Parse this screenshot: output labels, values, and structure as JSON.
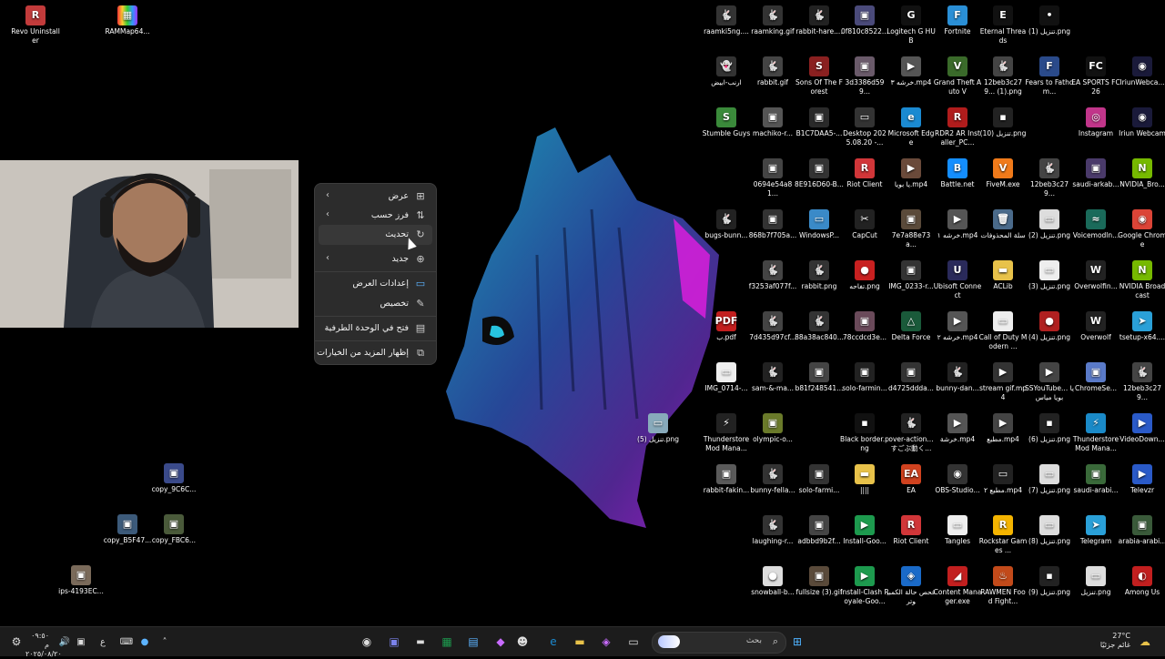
{
  "desktop": {
    "left_icons": [
      {
        "label": "Revo Uninstaller",
        "glyph": "R",
        "color": "#c23b3b"
      },
      {
        "label": "RAMMap64...",
        "glyph": "▦",
        "color": "#6b3fa0"
      },
      {
        "label": "copy_9C6C...",
        "glyph": "▣",
        "color": "#3a4a8a"
      },
      {
        "label": "copy_B5F47...",
        "glyph": "▣",
        "color": "#3c5a7a"
      },
      {
        "label": "copy_FBC6...",
        "glyph": "▣",
        "color": "#4a5a3a"
      },
      {
        "label": "ips-4193EC...",
        "glyph": "▣",
        "color": "#7a6a5a"
      }
    ],
    "grid_icons": [
      {
        "label": "raamki5ng....",
        "glyph": "🐇",
        "color": "#333"
      },
      {
        "label": "raamking.gif",
        "glyph": "🐇",
        "color": "#333"
      },
      {
        "label": "rabbit-hare....",
        "glyph": "🐇",
        "color": "#222"
      },
      {
        "label": "0f810c8522...",
        "glyph": "▣",
        "color": "#4a4a7a"
      },
      {
        "label": "Logitech G HUB",
        "glyph": "G",
        "color": "#111"
      },
      {
        "label": "Fortnite",
        "glyph": "F",
        "color": "#2a8fd6"
      },
      {
        "label": "Eternal Threads",
        "glyph": "E",
        "color": "#111"
      },
      {
        "label": "تنزيل (1).png",
        "glyph": "•",
        "color": "#111"
      },
      {
        "label": "ارنب-ابيض",
        "glyph": "👻",
        "color": "#333"
      },
      {
        "label": "rabbit.gif",
        "glyph": "🐇",
        "color": "#444"
      },
      {
        "label": "Sons Of The Forest",
        "glyph": "S",
        "color": "#8a2020"
      },
      {
        "label": "3d3386d599...",
        "glyph": "▣",
        "color": "#6a5a6a"
      },
      {
        "label": "خرشه ٣.mp4",
        "glyph": "▶",
        "color": "#555"
      },
      {
        "label": "Grand Theft Auto V",
        "glyph": "V",
        "color": "#3a6a2a"
      },
      {
        "label": "12beb3c279... (1).png",
        "glyph": "🐇",
        "color": "#444"
      },
      {
        "label": "Fears to Fathom...",
        "glyph": "F",
        "color": "#2a4a8a"
      },
      {
        "label": "EA SPORTS FC 26",
        "glyph": "FC",
        "color": "#111"
      },
      {
        "label": "IriunWebca...",
        "glyph": "◉",
        "color": "#1a1a3a"
      },
      {
        "label": "Stumble Guys",
        "glyph": "S",
        "color": "#3a8a3a"
      },
      {
        "label": "machiko-r...",
        "glyph": "▣",
        "color": "#555"
      },
      {
        "label": "B1C7DAA5-...",
        "glyph": "▣",
        "color": "#2a2a2a"
      },
      {
        "label": "Desktop 2025.08.20 -...",
        "glyph": "▭",
        "color": "#333"
      },
      {
        "label": "Microsoft Edge",
        "glyph": "e",
        "color": "#1b8ad1"
      },
      {
        "label": "RDR2 AR Installer_PC...",
        "glyph": "R",
        "color": "#b01c1c"
      },
      {
        "label": "تنزيل (10).png",
        "glyph": "▪",
        "color": "#222"
      },
      {
        "label": "Instagram",
        "glyph": "◎",
        "color": "#c1358a"
      },
      {
        "label": "Iriun Webcam",
        "glyph": "◉",
        "color": "#1a1a3a"
      },
      {
        "label": "0694e54a81...",
        "glyph": "▣",
        "color": "#444"
      },
      {
        "label": "8E916D60-B...",
        "glyph": "▣",
        "color": "#333"
      },
      {
        "label": "Riot Client",
        "glyph": "R",
        "color": "#d13639"
      },
      {
        "label": "يا بويا.mp4",
        "glyph": "▶",
        "color": "#6a4a3a"
      },
      {
        "label": "Battle.net",
        "glyph": "B",
        "color": "#148eff"
      },
      {
        "label": "FiveM.exe",
        "glyph": "V",
        "color": "#f07a1a"
      },
      {
        "label": "12beb3c279...",
        "glyph": "🐇",
        "color": "#444"
      },
      {
        "label": "saudi-arkab...",
        "glyph": "▣",
        "color": "#4a3a6a"
      },
      {
        "label": "NVIDIA_Bro...",
        "glyph": "N",
        "color": "#76b900"
      },
      {
        "label": "bugs-bunn...",
        "glyph": "🐇",
        "color": "#222"
      },
      {
        "label": "868b7f705a...",
        "glyph": "▣",
        "color": "#333"
      },
      {
        "label": "WindowsP...",
        "glyph": "▭",
        "color": "#3a8ac8"
      },
      {
        "label": "CapCut",
        "glyph": "✂",
        "color": "#222"
      },
      {
        "label": "7e7a88e73a...",
        "glyph": "▣",
        "color": "#5a4a3a"
      },
      {
        "label": "خرشه ١.mp4",
        "glyph": "▶",
        "color": "#555"
      },
      {
        "label": "سلة المحذوفات",
        "glyph": "🗑",
        "color": "#4a6a8a"
      },
      {
        "label": "تنزيل (2).png",
        "glyph": "▭",
        "color": "#ddd"
      },
      {
        "label": "Voicemodln...",
        "glyph": "≈",
        "color": "#1a6a5a"
      },
      {
        "label": "Google Chrome",
        "glyph": "◉",
        "color": "#db4437"
      },
      {
        "label": "f3253af077f...",
        "glyph": "🐇",
        "color": "#444"
      },
      {
        "label": "rabbit.png",
        "glyph": "🐇",
        "color": "#333"
      },
      {
        "label": "تفاحه.png",
        "glyph": "●",
        "color": "#c82020"
      },
      {
        "label": "IMG_0233-r...",
        "glyph": "▣",
        "color": "#333"
      },
      {
        "label": "Ubisoft Connect",
        "glyph": "U",
        "color": "#2a2a5a"
      },
      {
        "label": "ACLib",
        "glyph": "▬",
        "color": "#e8c24a"
      },
      {
        "label": "تنزيل (3).png",
        "glyph": "▭",
        "color": "#eee"
      },
      {
        "label": "Overwolfin...",
        "glyph": "W",
        "color": "#222"
      },
      {
        "label": "NVIDIA Broadcast",
        "glyph": "N",
        "color": "#76b900"
      },
      {
        "label": "ب.pdf",
        "glyph": "PDF",
        "color": "#c21f1f"
      },
      {
        "label": "7d435d97cf...",
        "glyph": "🐇",
        "color": "#444"
      },
      {
        "label": "88a38ac840...",
        "glyph": "🐇",
        "color": "#333"
      },
      {
        "label": "78ccdcd3e...",
        "glyph": "▣",
        "color": "#6a4a5a"
      },
      {
        "label": "Delta Force",
        "glyph": "△",
        "color": "#1a5a3a"
      },
      {
        "label": "خرشه ٢.mp4",
        "glyph": "▶",
        "color": "#555"
      },
      {
        "label": "Call of Duty Modern ...",
        "glyph": "▭",
        "color": "#eee"
      },
      {
        "label": "تنزيل (4).png",
        "glyph": "●",
        "color": "#b02020"
      },
      {
        "label": "Overwolf",
        "glyph": "W",
        "color": "#222"
      },
      {
        "label": "tsetup-x64....",
        "glyph": "➤",
        "color": "#2aa0d8"
      },
      {
        "label": "IMG_0714-...",
        "glyph": "▭",
        "color": "#eee"
      },
      {
        "label": "sam-&-ma...",
        "glyph": "🐇",
        "color": "#222"
      },
      {
        "label": "b81f248541...",
        "glyph": "▣",
        "color": "#444"
      },
      {
        "label": "solo-farmin...",
        "glyph": "▣",
        "color": "#222"
      },
      {
        "label": "d4725ddda...",
        "glyph": "▣",
        "color": "#333"
      },
      {
        "label": "bunny-dan...",
        "glyph": "🐇",
        "color": "#222"
      },
      {
        "label": "stream gif.mp4",
        "glyph": "▶",
        "color": "#333"
      },
      {
        "label": "SSYouTube... يابويا مياس",
        "glyph": "▶",
        "color": "#444"
      },
      {
        "label": "ChromeSe...",
        "glyph": "▣",
        "color": "#5a7ac8"
      },
      {
        "label": "12beb3c279...",
        "glyph": "🐇",
        "color": "#444"
      },
      {
        "label": "تنزيل (5).png",
        "glyph": "▭",
        "color": "#8ab"
      },
      {
        "label": "Thunderstore Mod Mana...",
        "glyph": "⚡",
        "color": "#222"
      },
      {
        "label": "olympic-o...",
        "glyph": "▣",
        "color": "#6a7a2a"
      },
      {
        "label": "Black border.png",
        "glyph": "▪",
        "color": "#111"
      },
      {
        "label": "over-action... すごぶ動く...",
        "glyph": "🐇",
        "color": "#222"
      },
      {
        "label": "خرشة.mp4",
        "glyph": "▶",
        "color": "#555"
      },
      {
        "label": "مطبع.mp4",
        "glyph": "▶",
        "color": "#444"
      },
      {
        "label": "تنزيل (6).png",
        "glyph": "▪",
        "color": "#222"
      },
      {
        "label": "Thunderstore Mod Mana...",
        "glyph": "⚡",
        "color": "#1a8ac8"
      },
      {
        "label": "VideoDown...",
        "glyph": "▶",
        "color": "#2a5ac8"
      },
      {
        "label": "rabbit-fakin...",
        "glyph": "▣",
        "color": "#5a5a5a"
      },
      {
        "label": "bunny-fella...",
        "glyph": "🐇",
        "color": "#333"
      },
      {
        "label": "solo-farmi...",
        "glyph": "▣",
        "color": "#333"
      },
      {
        "label": "||||",
        "glyph": "▬",
        "color": "#e8c24a"
      },
      {
        "label": "EA",
        "glyph": "EA",
        "color": "#d0421f"
      },
      {
        "label": "OBS-Studio...",
        "glyph": "◉",
        "color": "#333"
      },
      {
        "label": "مطبع ٢.mp4",
        "glyph": "▭",
        "color": "#222"
      },
      {
        "label": "تنزيل (7).png",
        "glyph": "▭",
        "color": "#ddd"
      },
      {
        "label": "saudi-arabi...",
        "glyph": "▣",
        "color": "#3a6a3a"
      },
      {
        "label": "Televzr",
        "glyph": "▶",
        "color": "#2a5ac8"
      },
      {
        "label": "laughing-r...",
        "glyph": "🐇",
        "color": "#333"
      },
      {
        "label": "adbbd9b2f...",
        "glyph": "▣",
        "color": "#444"
      },
      {
        "label": "Install-Goo...",
        "glyph": "▶",
        "color": "#1d9a4e"
      },
      {
        "label": "Riot Client",
        "glyph": "R",
        "color": "#d13639"
      },
      {
        "label": "Tangles",
        "glyph": "▭",
        "color": "#eee"
      },
      {
        "label": "Rockstar Games ...",
        "glyph": "R",
        "color": "#f4b400"
      },
      {
        "label": "تنزيل (8).png",
        "glyph": "▭",
        "color": "#ddd"
      },
      {
        "label": "Telegram",
        "glyph": "➤",
        "color": "#2aa0d8"
      },
      {
        "label": "arabia-arabi...",
        "glyph": "▣",
        "color": "#3a5a3a"
      },
      {
        "label": "snowball-b...",
        "glyph": "●",
        "color": "#ddd"
      },
      {
        "label": "fullsize (3).gif",
        "glyph": "▣",
        "color": "#5a4a3a"
      },
      {
        "label": "Install-Clash Royale-Goo...",
        "glyph": "▶",
        "color": "#1d9a4e"
      },
      {
        "label": "فحص حالة الكمبيوتر",
        "glyph": "◈",
        "color": "#1a6ac8"
      },
      {
        "label": "Content Manager.exe",
        "glyph": "◢",
        "color": "#c21f1f"
      },
      {
        "label": "RAWMEN Food Fight...",
        "glyph": "♨",
        "color": "#c24a1a"
      },
      {
        "label": "تنزيل (9).png",
        "glyph": "▪",
        "color": "#222"
      },
      {
        "label": "تنزيل.png",
        "glyph": "▭",
        "color": "#ddd"
      },
      {
        "label": "Among Us",
        "glyph": "◐",
        "color": "#c21f1f"
      }
    ]
  },
  "context_menu": {
    "items": [
      {
        "label": "عرض",
        "icon": "grid-icon",
        "glyph": "⊞",
        "submenu": true
      },
      {
        "label": "فرز حسب",
        "icon": "sort-icon",
        "glyph": "⇅",
        "submenu": true
      },
      {
        "label": "تحديث",
        "icon": "refresh-icon",
        "glyph": "↻",
        "submenu": false
      },
      {
        "label": "جديد",
        "icon": "new-icon",
        "glyph": "⊕",
        "submenu": true
      },
      {
        "label": "إعدادات العرض",
        "icon": "display-settings-icon",
        "glyph": "▭",
        "submenu": false
      },
      {
        "label": "تخصيص",
        "icon": "personalize-icon",
        "glyph": "✎",
        "submenu": false
      },
      {
        "label": "فتح في الوحدة الطرفية",
        "icon": "terminal-icon",
        "glyph": "▤",
        "submenu": false
      },
      {
        "label": "إظهار المزيد من الخيارات",
        "icon": "more-options-icon",
        "glyph": "⧉",
        "submenu": false
      }
    ]
  },
  "taskbar": {
    "search_placeholder": "بحث",
    "weather_temp": "27°C",
    "weather_text": "غائم جزئيًا",
    "clock_time": "٠٩:٥٠ م",
    "clock_date": "٢٠٢٥/٠٨/٢٠",
    "lang": "ع"
  }
}
